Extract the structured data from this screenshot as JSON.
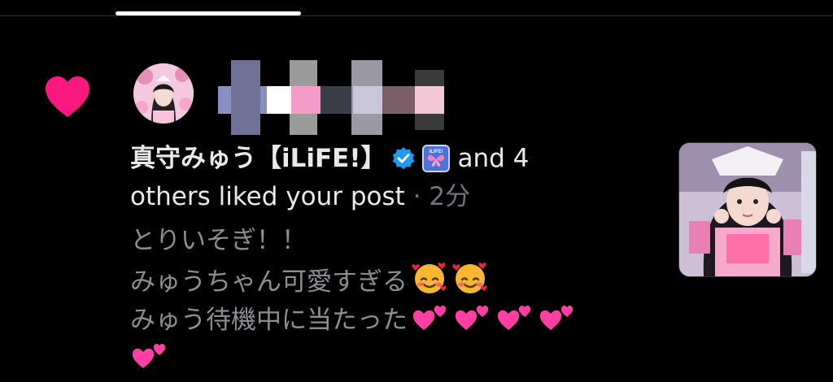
{
  "notification": {
    "type": "like",
    "liker_name": "真守みゅう【iLiFE!】",
    "others_text": "and 4",
    "line2_text": "others liked your post",
    "separator": "·",
    "time_ago": "2分",
    "post_lines": [
      "とりいそぎ！！",
      "みゅうちゃん可愛すぎる",
      "みゅう待機中に当たった"
    ],
    "emojis": {
      "line2": [
        "smiling-face-with-hearts",
        "smiling-face-with-hearts"
      ],
      "line3": [
        "two-hearts",
        "two-hearts",
        "two-hearts",
        "two-hearts"
      ],
      "line4": [
        "two-hearts"
      ]
    },
    "affiliate_badge_text": "iLiFE!"
  },
  "colors": {
    "like_heart": "#f91880",
    "verified_badge": "#1d9bf0",
    "text_primary": "#e7e9ea",
    "text_secondary": "#71767b",
    "background": "#000000"
  }
}
